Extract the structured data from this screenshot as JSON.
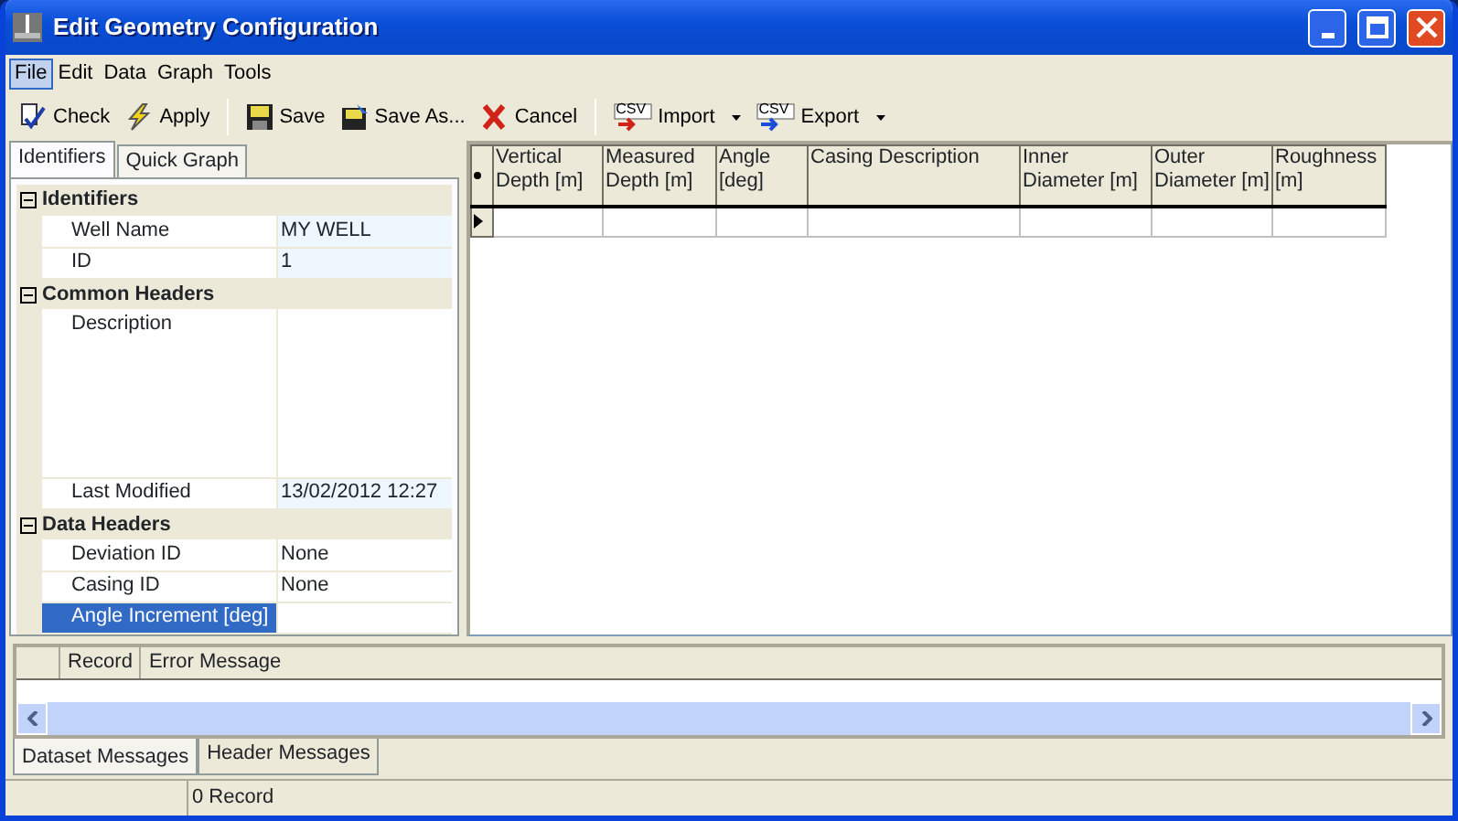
{
  "window": {
    "title": "Edit Geometry Configuration"
  },
  "menu": [
    {
      "label": "File",
      "selected": true
    },
    {
      "label": "Edit",
      "selected": false
    },
    {
      "label": "Data",
      "selected": false
    },
    {
      "label": "Graph",
      "selected": false
    },
    {
      "label": "Tools",
      "selected": false
    }
  ],
  "toolbar": [
    [
      {
        "label": "Check",
        "dropdown": false
      },
      {
        "label": "Apply",
        "dropdown": false
      }
    ],
    [
      {
        "label": "Save",
        "dropdown": false
      },
      {
        "label": "Save As...",
        "dropdown": false
      },
      {
        "label": "Cancel",
        "dropdown": false
      }
    ],
    [
      {
        "label": "Import",
        "icon_text": "CSV",
        "dropdown": true
      },
      {
        "label": "Export",
        "icon_text": "CSV",
        "dropdown": true
      }
    ]
  ],
  "left_tabs": [
    {
      "label": "Identifiers",
      "selected": true
    },
    {
      "label": "Quick Graph",
      "selected": false
    }
  ],
  "properties": [
    {
      "category": "Identifiers",
      "expanded": true,
      "rows": [
        {
          "name": "Well Name",
          "value": "MY WELL",
          "readonly": true,
          "selected": false,
          "multiline": false
        },
        {
          "name": "ID",
          "value": "1",
          "readonly": true,
          "selected": false,
          "multiline": false
        }
      ]
    },
    {
      "category": "Common Headers",
      "expanded": true,
      "rows": [
        {
          "name": "Description",
          "value": "",
          "readonly": false,
          "selected": false,
          "multiline": true
        },
        {
          "name": "Last Modified",
          "value": "13/02/2012 12:27",
          "readonly": true,
          "selected": false,
          "multiline": false
        }
      ]
    },
    {
      "category": "Data Headers",
      "expanded": true,
      "rows": [
        {
          "name": "Deviation ID",
          "value": "None",
          "readonly": false,
          "selected": false,
          "multiline": false
        },
        {
          "name": "Casing ID",
          "value": "None",
          "readonly": false,
          "selected": false,
          "multiline": false
        },
        {
          "name": "Angle Increment [deg]",
          "value": "",
          "readonly": false,
          "selected": true,
          "multiline": false
        }
      ]
    }
  ],
  "grid": {
    "columns": [
      "Vertical Depth [m]",
      "Measured Depth [m]",
      "Angle [deg]",
      "Casing Description",
      "Inner Diameter [m]",
      "Outer Diameter [m]",
      "Roughness [m]"
    ],
    "new_row": true
  },
  "messages": {
    "columns": [
      "Record",
      "Error Message"
    ]
  },
  "bottom_tabs": [
    {
      "label": "Dataset Messages",
      "selected": true
    },
    {
      "label": "Header Messages",
      "selected": false
    }
  ],
  "status_bar": {
    "text": "0 Record"
  }
}
